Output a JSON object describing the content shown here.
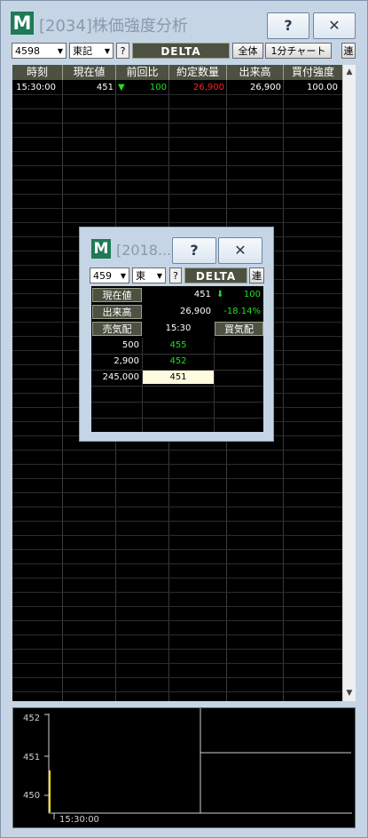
{
  "window": {
    "title": "[2034]株価強度分析",
    "logo_letter": "M",
    "help_label": "?",
    "close_label": "✕"
  },
  "toolbar": {
    "code_value": "4598",
    "market_value": "東記",
    "help_label": "?",
    "delta_label": "DELTA",
    "all_label": "全体",
    "chart_label": "1分チャート",
    "ren_label": "連"
  },
  "table": {
    "headers": [
      "時刻",
      "現在値",
      "前回比",
      "約定数量",
      "出来高",
      "買付強度"
    ],
    "rows": [
      {
        "time": "15:30:00",
        "price": "451",
        "arrow": "▼",
        "change": "100",
        "qty": "26,900",
        "volume": "26,900",
        "strength": "100.00"
      }
    ]
  },
  "chart": {
    "y_ticks": [
      "452",
      "451",
      "450"
    ],
    "x_tick": "15:30:00"
  },
  "popup": {
    "title": "[2018...",
    "logo_letter": "M",
    "help_label": "?",
    "close_label": "✕",
    "code_value": "459",
    "market_value": "東",
    "qhelp_label": "?",
    "delta_label": "DELTA",
    "ren_label": "連",
    "current_label": "現在値",
    "current_value": "451",
    "current_arrow": "⬇",
    "current_change": "100",
    "volume_label": "出来高",
    "volume_value": "26,900",
    "volume_change": "-18.14%",
    "sell_label": "売気配",
    "time_value": "15:30",
    "buy_label": "買気配",
    "board": [
      {
        "qty": "500",
        "price": "455"
      },
      {
        "qty": "2,900",
        "price": "452"
      },
      {
        "qty": "245,000",
        "price": "451"
      }
    ]
  },
  "colors": {
    "up_green": "#22dd22",
    "down_red": "#ff2020",
    "header_olive": "#4c5142"
  }
}
